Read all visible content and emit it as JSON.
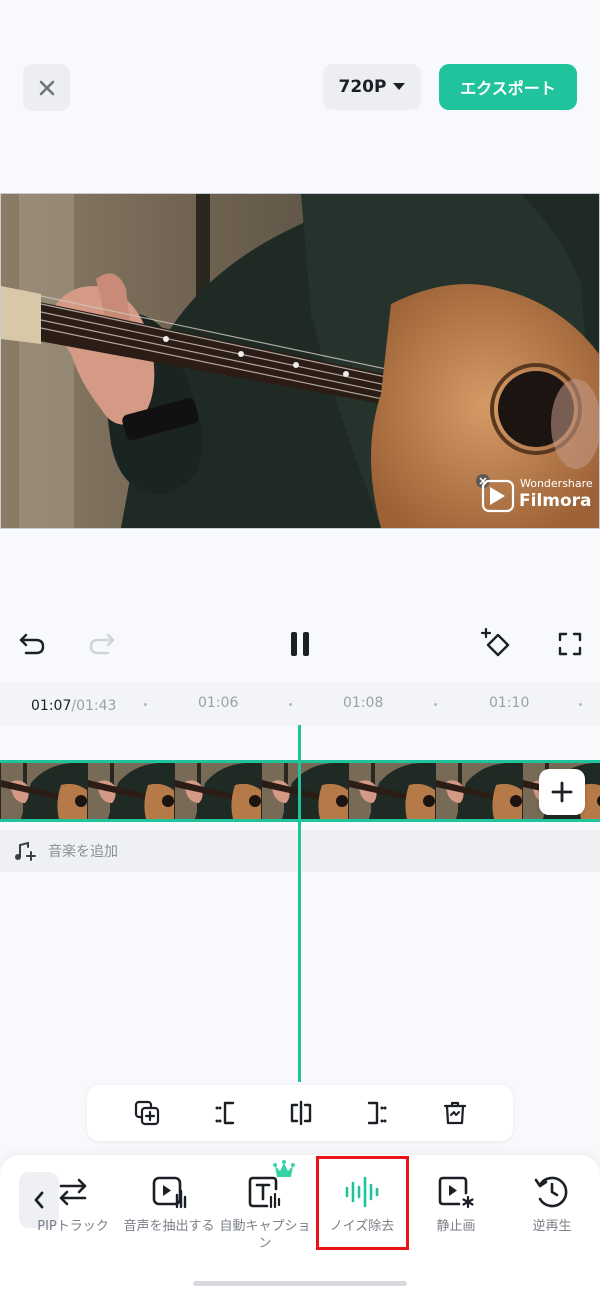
{
  "header": {
    "resolution": "720P",
    "export_label": "エクスポート"
  },
  "preview": {
    "watermark_brand_top": "Wondershare",
    "watermark_brand_bottom": "Filmora"
  },
  "timeline": {
    "current_time": "01:07",
    "total_time": "/01:43",
    "ticks": [
      "01:06",
      "01:08",
      "01:10"
    ]
  },
  "music": {
    "add_label": "音楽を追加"
  },
  "tools": [
    {
      "label": "PIPトラック",
      "icon": "pip-swap-icon"
    },
    {
      "label": "音声を抽出する",
      "icon": "extract-audio-icon"
    },
    {
      "label": "自動キャプション",
      "icon": "auto-caption-icon"
    },
    {
      "label": "ノイズ除去",
      "icon": "noise-reduction-icon"
    },
    {
      "label": "静止画",
      "icon": "freeze-frame-icon"
    },
    {
      "label": "逆再生",
      "icon": "reverse-icon"
    }
  ],
  "colors": {
    "accent": "#1fc39c",
    "highlight": "#e8141a"
  }
}
